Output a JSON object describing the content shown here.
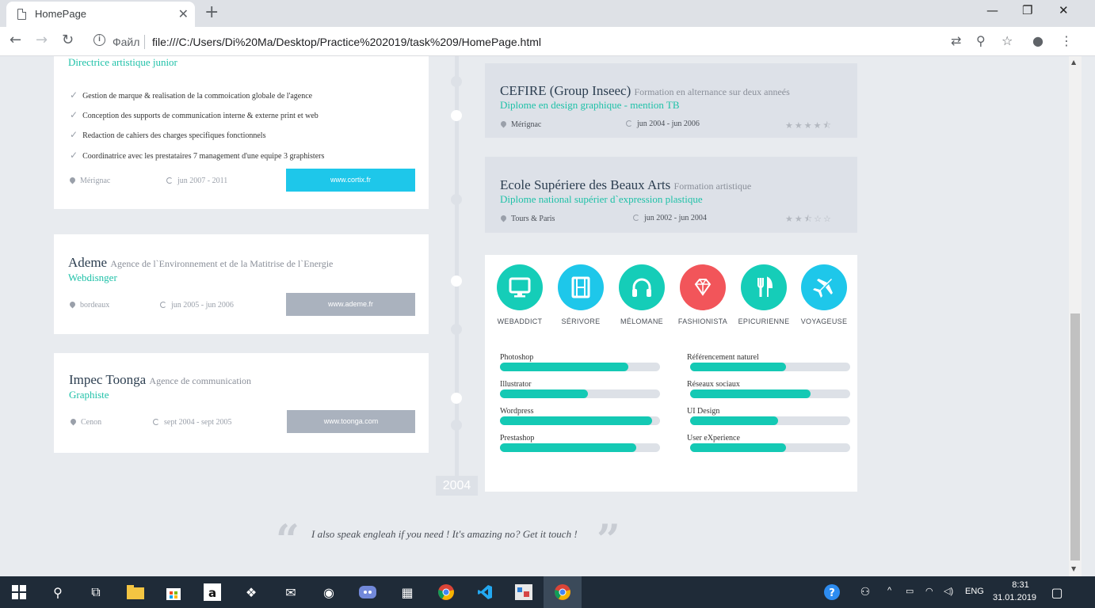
{
  "browser": {
    "tab_title": "HomePage",
    "scheme_label": "Файл",
    "url": "file:///C:/Users/Di%20Ma/Desktop/Practice%202019/task%209/HomePage.html"
  },
  "experience": [
    {
      "role": "Directrice artistique junior",
      "bullets": [
        "Gestion de marque & realisation de la commoication globale de l'agence",
        "Conception des supports de communication interne & externe print et web",
        "Redaction de cahiers des charges specifiques fonctionnels",
        "Coordinatrice avec les prestataires 7 management d'une equipe 3 graphisters"
      ],
      "location": "Mérignac",
      "dates": "jun 2007 - 2011",
      "site": "www.cortix.fr",
      "site_color": "#1ec7ea"
    },
    {
      "company": "Ademe",
      "company_desc": "Agence de l`Environnement et de la Matitrise de l`Energie",
      "role": "Webdisnger",
      "location": "bordeaux",
      "dates": "jun 2005 - jun 2006",
      "site": "www.ademe.fr",
      "site_color": "#aab2be"
    },
    {
      "company": "Impec Toonga",
      "company_desc": "Agence de communication",
      "role": "Graphiste",
      "location": "Cenon",
      "dates": "sept 2004 - sept 2005",
      "site": "www.toonga.com",
      "site_color": "#aab2be"
    }
  ],
  "timeline_year": "2004",
  "education": [
    {
      "school": "CEFIRE (Group Inseec)",
      "school_desc": "Formation en alternance sur deux annеés",
      "diploma": "Diplome en design graphique - mention TB",
      "location": "Mérignac",
      "dates": "jun 2004 - jun 2006",
      "rating": 4.5,
      "stars": "★★★★⯪"
    },
    {
      "school": "Ecole Supériere des Beaux Arts",
      "school_desc": "Formation artistique",
      "diploma": "Diplome national supérier d`expression plastique",
      "location": "Tours & Paris",
      "dates": "jun 2002 - jun 2004",
      "rating": 2.5,
      "stars": "★★⯪☆☆"
    }
  ],
  "interests": [
    {
      "label": "WEBADDICT",
      "icon": "monitor-icon",
      "color": "#15cdb8"
    },
    {
      "label": "SÉRIVORE",
      "icon": "film-icon",
      "color": "#1ec7ea"
    },
    {
      "label": "MÉLOMANE",
      "icon": "headphones-icon",
      "color": "#15cdb8"
    },
    {
      "label": "FASHIONISTA",
      "icon": "diamond-icon",
      "color": "#f2555a"
    },
    {
      "label": "EPICURIENNE",
      "icon": "cutlery-icon",
      "color": "#15cdb8"
    },
    {
      "label": "VOYAGEUSE",
      "icon": "plane-icon",
      "color": "#1ec7ea"
    }
  ],
  "skills": [
    {
      "name": "Photoshop",
      "level": 0.8
    },
    {
      "name": "Référencement naturel",
      "level": 0.6
    },
    {
      "name": "Illustrator",
      "level": 0.55
    },
    {
      "name": "Réseaux sociaux",
      "level": 0.75
    },
    {
      "name": "Wordpress",
      "level": 0.95
    },
    {
      "name": "UI Design",
      "level": 0.55
    },
    {
      "name": "Prestashop",
      "level": 0.85
    },
    {
      "name": "User eXperience",
      "level": 0.6
    }
  ],
  "quote": "I also speak engleah if you need ! It's amazing no? Get it touch !",
  "taskbar": {
    "lang": "ENG",
    "time": "8:31",
    "date": "31.01.2019"
  }
}
